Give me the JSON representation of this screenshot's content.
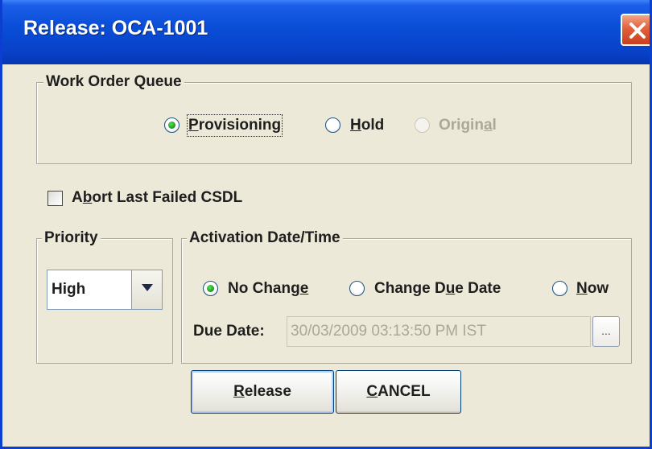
{
  "window": {
    "title": "Release: OCA-1001"
  },
  "work_order_queue": {
    "legend": "Work Order Queue",
    "options": [
      {
        "pre": "",
        "mnemonic": "P",
        "post": "rovisioning",
        "checked": true,
        "enabled": true
      },
      {
        "pre": "",
        "mnemonic": "H",
        "post": "old",
        "checked": false,
        "enabled": true
      },
      {
        "pre": "Origin",
        "mnemonic": "a",
        "post": "l",
        "checked": false,
        "enabled": false
      }
    ]
  },
  "abort_checkbox": {
    "pre": "A",
    "mnemonic": "b",
    "post": "ort Last Failed CSDL",
    "checked": false
  },
  "priority": {
    "legend": "Priority",
    "selected": "High"
  },
  "activation": {
    "legend": "Activation Date/Time",
    "options": [
      {
        "pre": "No Chang",
        "mnemonic": "e",
        "post": "",
        "checked": true
      },
      {
        "pre": "Change D",
        "mnemonic": "u",
        "post": "e Date",
        "checked": false
      },
      {
        "pre": "",
        "mnemonic": "N",
        "post": "ow",
        "checked": false
      }
    ],
    "due_date_label": "Due Date:",
    "due_date_value": "30/03/2009 03:13:50 PM IST",
    "ellipsis_label": "..."
  },
  "buttons": {
    "release": {
      "pre": "",
      "mnemonic": "R",
      "post": "elease"
    },
    "cancel": {
      "pre": "",
      "mnemonic": "C",
      "post": "ANCEL"
    }
  },
  "colors": {
    "title_bar": "#0842c8",
    "dialog_bg": "#ece9d8",
    "radio_dot": "#22a022",
    "disabled_text": "#aca899"
  }
}
